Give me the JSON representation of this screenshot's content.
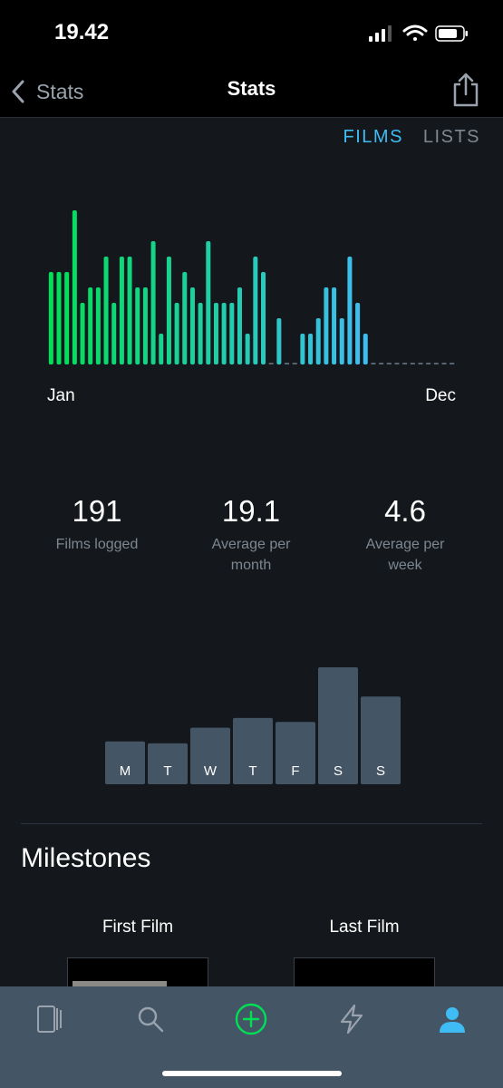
{
  "status": {
    "time": "19.42"
  },
  "nav": {
    "back_label": "Stats",
    "title": "Stats"
  },
  "tabs": [
    {
      "label": "FILMS",
      "active": true
    },
    {
      "label": "LISTS",
      "active": false
    }
  ],
  "chart_data": [
    {
      "type": "bar",
      "x_start_label": "Jan",
      "x_end_label": "Dec",
      "values": [
        6,
        6,
        6,
        10,
        4,
        5,
        5,
        7,
        4,
        7,
        7,
        5,
        5,
        8,
        2,
        7,
        4,
        6,
        5,
        4,
        8,
        4,
        4,
        4,
        5,
        2,
        7,
        6,
        0,
        3,
        0,
        0,
        2,
        2,
        3,
        5,
        5,
        3,
        7,
        4,
        2
      ],
      "empty_slots_remaining": 11,
      "bar_color_gradient": [
        "#00e054",
        "#40bcf4"
      ]
    },
    {
      "type": "bar",
      "categories": [
        "M",
        "T",
        "W",
        "T",
        "F",
        "S",
        "S"
      ],
      "values": [
        11,
        10.5,
        14.5,
        17,
        16,
        30,
        22.5
      ],
      "color": "#445566"
    }
  ],
  "stats": [
    {
      "value": "191",
      "label": "Films logged"
    },
    {
      "value": "19.1",
      "label": "Average per month"
    },
    {
      "value": "4.6",
      "label": "Average per week"
    }
  ],
  "milestones": {
    "title": "Milestones",
    "first_label": "First Film",
    "last_label": "Last Film"
  },
  "tabbar": [
    {
      "icon": "films-icon",
      "active": false
    },
    {
      "icon": "search-icon",
      "active": false
    },
    {
      "icon": "add-icon",
      "active": false
    },
    {
      "icon": "activity-icon",
      "active": false
    },
    {
      "icon": "profile-icon",
      "active": true
    }
  ],
  "colors": {
    "accent_blue": "#40bcf4",
    "accent_green": "#00e054",
    "background": "#14181c",
    "tabbar": "#445566"
  }
}
